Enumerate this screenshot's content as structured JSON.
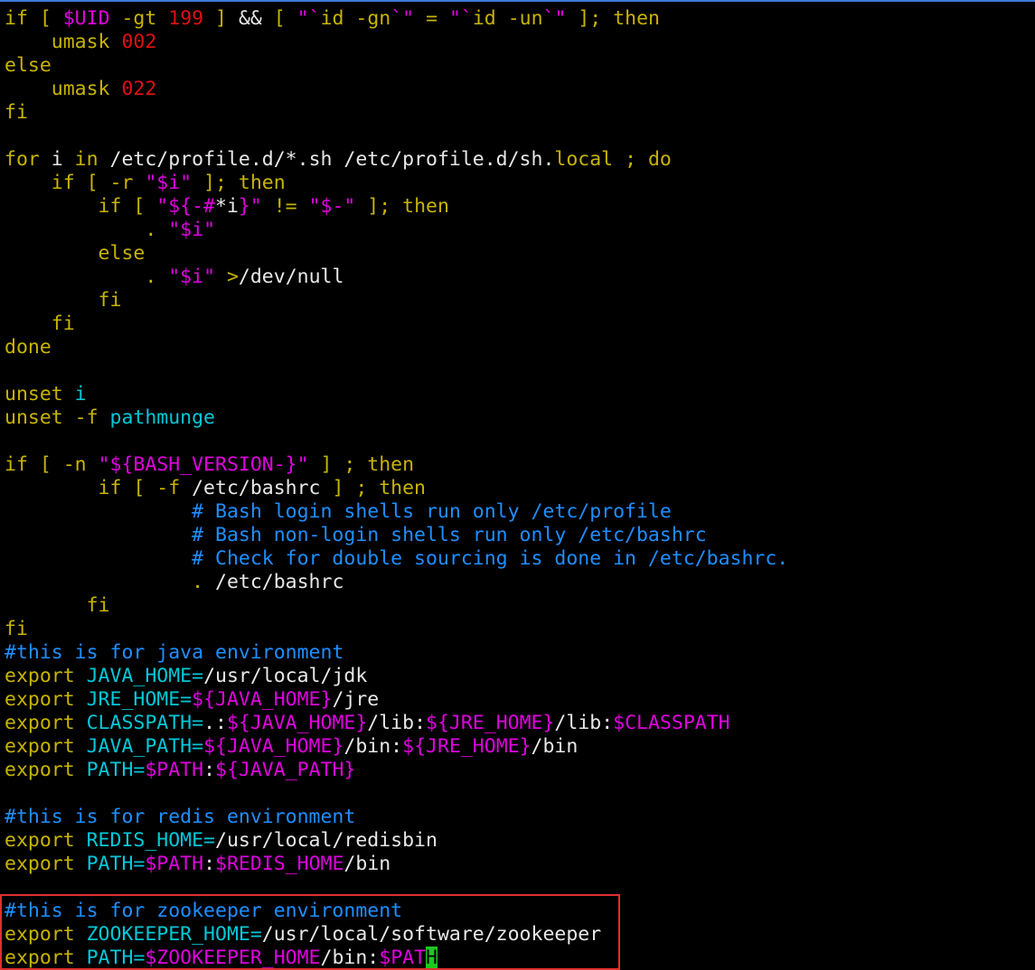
{
  "colors": {
    "background": "#000000",
    "keyword": "#c8b400",
    "variable": "#e000e0",
    "number": "#e01010",
    "comment": "#1e8fff",
    "text": "#e8e8e8",
    "cyan": "#00c8d8",
    "cursor": "#1ec81e",
    "highlight_box": "#e03030"
  },
  "lines": [
    [
      [
        "kw",
        "if [ "
      ],
      [
        "var",
        "$UID"
      ],
      [
        "kw",
        " -gt "
      ],
      [
        "num",
        "199"
      ],
      [
        "kw",
        " ] "
      ],
      [
        "txt",
        "&&"
      ],
      [
        "kw",
        " [ "
      ],
      [
        "str",
        "\"`"
      ],
      [
        "kw",
        "id -gn"
      ],
      [
        "str",
        "`\""
      ],
      [
        "kw",
        " = "
      ],
      [
        "str",
        "\"`"
      ],
      [
        "kw",
        "id -un"
      ],
      [
        "str",
        "`\""
      ],
      [
        "kw",
        " ]; then"
      ]
    ],
    [
      [
        "kw",
        "    umask "
      ],
      [
        "num",
        "002"
      ]
    ],
    [
      [
        "kw",
        "else"
      ]
    ],
    [
      [
        "kw",
        "    umask "
      ],
      [
        "num",
        "022"
      ]
    ],
    [
      [
        "kw",
        "fi"
      ]
    ],
    [
      [
        "txt",
        ""
      ]
    ],
    [
      [
        "kw",
        "for "
      ],
      [
        "txt",
        "i "
      ],
      [
        "kw",
        "in "
      ],
      [
        "txt",
        "/etc/profile.d/*.sh /etc/profile.d/sh."
      ],
      [
        "kw",
        "local"
      ],
      [
        "txt",
        " "
      ],
      [
        "kw",
        "; do"
      ]
    ],
    [
      [
        "kw",
        "    if [ -r "
      ],
      [
        "str",
        "\"$i\""
      ],
      [
        "kw",
        " ]; then"
      ]
    ],
    [
      [
        "kw",
        "        if [ "
      ],
      [
        "str",
        "\"${-#"
      ],
      [
        "txt",
        "*i"
      ],
      [
        "str",
        "}\""
      ],
      [
        "kw",
        " != "
      ],
      [
        "str",
        "\"$-\""
      ],
      [
        "kw",
        " ]; then"
      ]
    ],
    [
      [
        "txt",
        "            "
      ],
      [
        "kw",
        ". "
      ],
      [
        "str",
        "\"$i\""
      ]
    ],
    [
      [
        "kw",
        "        else"
      ]
    ],
    [
      [
        "txt",
        "            "
      ],
      [
        "kw",
        ". "
      ],
      [
        "str",
        "\"$i\""
      ],
      [
        "txt",
        " "
      ],
      [
        "kw",
        ">"
      ],
      [
        "txt",
        "/dev/null"
      ]
    ],
    [
      [
        "kw",
        "        fi"
      ]
    ],
    [
      [
        "kw",
        "    fi"
      ]
    ],
    [
      [
        "kw",
        "done"
      ]
    ],
    [
      [
        "txt",
        ""
      ]
    ],
    [
      [
        "kw",
        "unset "
      ],
      [
        "cyan",
        "i"
      ]
    ],
    [
      [
        "kw",
        "unset -f "
      ],
      [
        "cyan",
        "pathmunge"
      ]
    ],
    [
      [
        "txt",
        ""
      ]
    ],
    [
      [
        "kw",
        "if [ -n "
      ],
      [
        "str",
        "\"${BASH_VERSION-}\""
      ],
      [
        "kw",
        " ] ; then"
      ]
    ],
    [
      [
        "kw",
        "        if [ -f "
      ],
      [
        "txt",
        "/etc/bashrc"
      ],
      [
        "kw",
        " ] ; then"
      ]
    ],
    [
      [
        "cmt",
        "                # Bash login shells run only /etc/profile"
      ]
    ],
    [
      [
        "cmt",
        "                # Bash non-login shells run only /etc/bashrc"
      ]
    ],
    [
      [
        "cmt",
        "                # Check for double sourcing is done in /etc/bashrc."
      ]
    ],
    [
      [
        "txt",
        "                "
      ],
      [
        "kw",
        ". "
      ],
      [
        "txt",
        "/etc/bashrc"
      ]
    ],
    [
      [
        "kw",
        "       fi"
      ]
    ],
    [
      [
        "kw",
        "fi"
      ]
    ],
    [
      [
        "cmt",
        "#this is for java environment"
      ]
    ],
    [
      [
        "kw",
        "export "
      ],
      [
        "cyan",
        "JAVA_HOME="
      ],
      [
        "txt",
        "/usr/local/jdk"
      ]
    ],
    [
      [
        "kw",
        "export "
      ],
      [
        "cyan",
        "JRE_HOME="
      ],
      [
        "var",
        "${JAVA_HOME}"
      ],
      [
        "txt",
        "/jre"
      ]
    ],
    [
      [
        "kw",
        "export "
      ],
      [
        "cyan",
        "CLASSPATH="
      ],
      [
        "txt",
        ".:"
      ],
      [
        "var",
        "${JAVA_HOME}"
      ],
      [
        "txt",
        "/lib:"
      ],
      [
        "var",
        "${JRE_HOME}"
      ],
      [
        "txt",
        "/lib:"
      ],
      [
        "var",
        "$CLASSPATH"
      ]
    ],
    [
      [
        "kw",
        "export "
      ],
      [
        "cyan",
        "JAVA_PATH="
      ],
      [
        "var",
        "${JAVA_HOME}"
      ],
      [
        "txt",
        "/bin:"
      ],
      [
        "var",
        "${JRE_HOME}"
      ],
      [
        "txt",
        "/bin"
      ]
    ],
    [
      [
        "kw",
        "export "
      ],
      [
        "cyan",
        "PATH="
      ],
      [
        "var",
        "$PATH"
      ],
      [
        "txt",
        ":"
      ],
      [
        "var",
        "${JAVA_PATH}"
      ]
    ],
    [
      [
        "txt",
        ""
      ]
    ],
    [
      [
        "cmt",
        "#this is for redis environment"
      ]
    ],
    [
      [
        "kw",
        "export "
      ],
      [
        "cyan",
        "REDIS_HOME="
      ],
      [
        "txt",
        "/usr/local/redisbin"
      ]
    ],
    [
      [
        "kw",
        "export "
      ],
      [
        "cyan",
        "PATH="
      ],
      [
        "var",
        "$PATH"
      ],
      [
        "txt",
        ":"
      ],
      [
        "var",
        "$REDIS_HOME"
      ],
      [
        "txt",
        "/bin"
      ]
    ],
    [
      [
        "txt",
        ""
      ]
    ],
    [
      [
        "cmt",
        "#this is for zookeeper environment"
      ]
    ],
    [
      [
        "kw",
        "export "
      ],
      [
        "cyan",
        "ZOOKEEPER_HOME="
      ],
      [
        "txt",
        "/usr/local/software/zookeeper"
      ]
    ],
    [
      [
        "kw",
        "export "
      ],
      [
        "cyan",
        "PATH="
      ],
      [
        "var",
        "$ZOOKEEPER_HOME"
      ],
      [
        "txt",
        "/bin:"
      ],
      [
        "var",
        "$PAT"
      ],
      [
        "cursor",
        "H"
      ]
    ]
  ]
}
